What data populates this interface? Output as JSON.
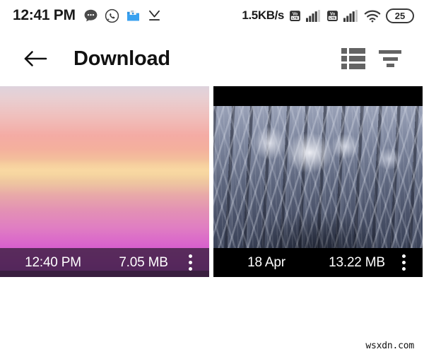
{
  "status_bar": {
    "clock": "12:41 PM",
    "network_speed": "1.5KB/s",
    "battery_level": "25",
    "left_icons": [
      {
        "name": "messages-icon",
        "label": "Messages"
      },
      {
        "name": "whatsapp-icon",
        "label": "WhatsApp"
      },
      {
        "name": "file-manager-icon",
        "label": "File Manager"
      },
      {
        "name": "download-complete-icon",
        "label": "Download complete"
      }
    ],
    "right_icons": [
      {
        "name": "volte-sim1-icon",
        "label": "VoLTE"
      },
      {
        "name": "signal-sim1-icon",
        "label": "Signal SIM 1"
      },
      {
        "name": "volte-sim2-icon",
        "label": "VoLTE"
      },
      {
        "name": "signal-sim2-icon",
        "label": "Signal SIM 2"
      },
      {
        "name": "wifi-icon",
        "label": "Wi-Fi"
      },
      {
        "name": "battery-icon",
        "label": "Battery"
      }
    ],
    "volte_top": "Vo",
    "volte_bottom": "LTE"
  },
  "app_bar": {
    "back_label": "Back",
    "title": "Download",
    "actions": [
      {
        "name": "list-view-button",
        "label": "List view"
      },
      {
        "name": "sort-button",
        "label": "Sort"
      }
    ]
  },
  "gallery": {
    "items": [
      {
        "thumbnail": "sunset-gradient-photo",
        "time": "12:40 PM",
        "size": "7.05 MB",
        "overflow_label": "More options"
      },
      {
        "thumbnail": "snowy-forest-photo",
        "time": "18 Apr",
        "size": "13.22 MB",
        "overflow_label": "More options"
      }
    ]
  },
  "footer": {
    "watermark": "wsxdn.com"
  },
  "colors": {
    "page_background": "#ffffff",
    "title_text": "#111111",
    "icon_grey": "#636363",
    "info_bar_purple": "#3a1f3e",
    "info_bar_black": "#000000",
    "info_text": "#ffffff"
  }
}
